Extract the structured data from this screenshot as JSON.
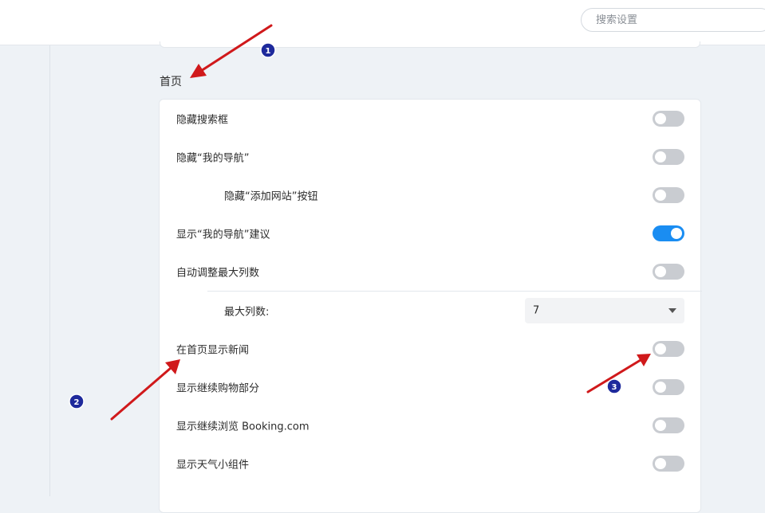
{
  "search": {
    "placeholder": "搜索设置"
  },
  "section": {
    "title": "首页"
  },
  "settings": [
    {
      "label": "隐藏搜索框",
      "enabled": false
    },
    {
      "label": "隐藏“我的导航”",
      "enabled": false
    },
    {
      "label": "隐藏“添加网站”按钮",
      "enabled": false
    },
    {
      "label": "显示“我的导航”建议",
      "enabled": true
    },
    {
      "label": "自动调整最大列数",
      "enabled": false
    },
    {
      "label": "最大列数:",
      "value": "7"
    },
    {
      "label": "在首页显示新闻",
      "enabled": false
    },
    {
      "label": "显示继续购物部分",
      "enabled": false
    },
    {
      "label": "显示继续浏览 Booking.com",
      "enabled": false
    },
    {
      "label": "显示天气小组件",
      "enabled": false
    }
  ],
  "annotations": {
    "badges": [
      "1",
      "2",
      "3"
    ],
    "arrow_color": "#d0191b",
    "badge_color": "#1e2a9c"
  },
  "colors": {
    "toggle_on": "#1a8df2",
    "toggle_off": "#c9ccd1",
    "page_bg": "#eef2f6"
  }
}
